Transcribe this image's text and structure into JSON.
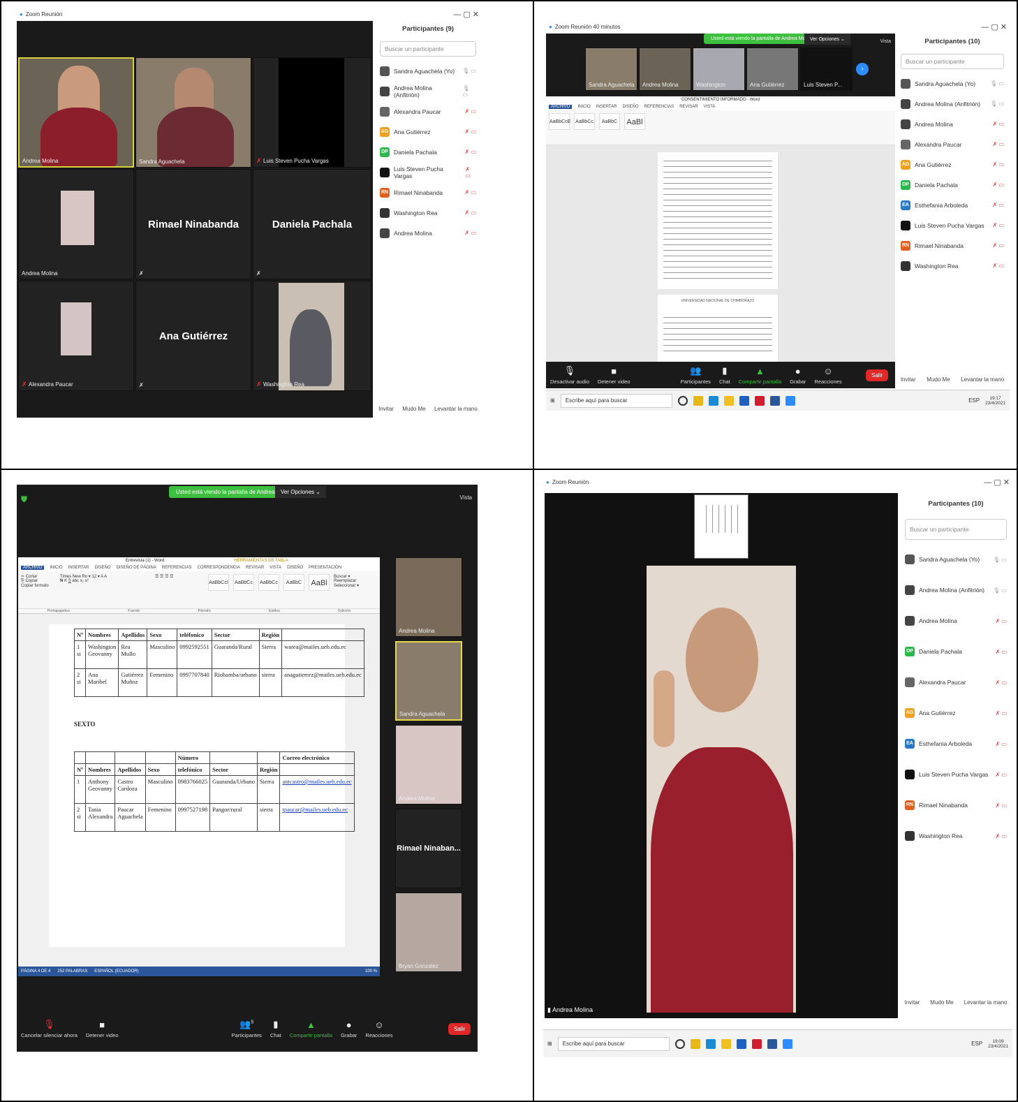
{
  "q1": {
    "window_title": "Zoom Reunión",
    "tiles": [
      {
        "name": "Andrea Molina"
      },
      {
        "name": "Sandra Aguachela"
      },
      {
        "name": "Luis Steven Pucha Vargas"
      },
      {
        "name": "Andrea Molina"
      },
      {
        "name": "",
        "big": "Rimael Ninabanda"
      },
      {
        "name": "",
        "big": "Daniela Pachala"
      },
      {
        "name": "Alexandra Paucar"
      },
      {
        "name": "",
        "big": "Ana Gutiérrez"
      },
      {
        "name": "Washington Rea"
      }
    ],
    "panel": {
      "title": "Participantes (9)",
      "search_placeholder": "Buscar un participante",
      "participants": [
        {
          "name": "Sandra Aguachela (Yo)",
          "avatar": "",
          "color": "#555"
        },
        {
          "name": "Andrea Molina (Anfitrión)",
          "avatar": "",
          "color": "#444"
        },
        {
          "name": "Alexandra Paucar",
          "avatar": "",
          "color": "#666"
        },
        {
          "name": "Ana Gutiérrez",
          "avatar": "AG",
          "color": "#f0a020"
        },
        {
          "name": "Daniela Pachala",
          "avatar": "DP",
          "color": "#2db84b"
        },
        {
          "name": "Luis Steven Pucha Vargas",
          "avatar": "",
          "color": "#111"
        },
        {
          "name": "Rimael Ninabanda",
          "avatar": "RN",
          "color": "#e06020"
        },
        {
          "name": "Washington Rea",
          "avatar": "",
          "color": "#333"
        },
        {
          "name": "Andrea Molina",
          "avatar": "",
          "color": "#444"
        }
      ],
      "footer": [
        "Invitar",
        "Mudo Me",
        "Levantar la mano"
      ]
    }
  },
  "q2": {
    "window_title": "Zoom Reunión 40 minutos",
    "banner": "Usted está viendo la pantalla de Andrea Molina",
    "options": "Ver Opciones ⌄",
    "view": "Vista",
    "thumbs": [
      "Sandra Aguachela",
      "Andrea Molina",
      "Washington",
      "Ana Gutiérrez",
      "Luis Steven P..."
    ],
    "doc_title": "CONSENTIMIENTO INFORMADO - Word",
    "doc_page2_header": "UNIVERSIDAD NACIONAL DE CHIMBORAZO",
    "panel": {
      "title": "Participantes (10)",
      "search_placeholder": "Buscar un participante",
      "participants": [
        {
          "name": "Sandra Aguachela (Yo)",
          "avatar": "",
          "color": "#555"
        },
        {
          "name": "Andrea Molina (Anfitrión)",
          "avatar": "",
          "color": "#444"
        },
        {
          "name": "Andrea Molina",
          "avatar": "",
          "color": "#444"
        },
        {
          "name": "Alexandra Paucar",
          "avatar": "",
          "color": "#666"
        },
        {
          "name": "Ana Gutiérrez",
          "avatar": "AG",
          "color": "#f0a020"
        },
        {
          "name": "Daniela Pachala",
          "avatar": "DP",
          "color": "#2db84b"
        },
        {
          "name": "Esthefania Arboleda",
          "avatar": "EA",
          "color": "#2a78c8"
        },
        {
          "name": "Luis Steven Pucha Vargas",
          "avatar": "",
          "color": "#111"
        },
        {
          "name": "Rimael Ninabanda",
          "avatar": "RN",
          "color": "#e06020"
        },
        {
          "name": "Washington Rea",
          "avatar": "",
          "color": "#333"
        }
      ],
      "footer": [
        "Invitar",
        "Mudo Me",
        "Levantar la mano"
      ]
    },
    "toolbar": [
      "Desactivar audio",
      "Detener video",
      "Participantes",
      "Chat",
      "Compartir pantalla",
      "Grabar",
      "Reacciones"
    ],
    "leave": "Salir",
    "taskbar": {
      "search": "Escribe aquí para buscar",
      "lang": "ESP",
      "time": "19:17",
      "date": "23/4/2021"
    }
  },
  "q3": {
    "banner": "Usted está viendo la pantalla de Andrea Molina",
    "options": "Ver Opciones ⌄",
    "view": "Vista",
    "word_title": "Entrevista (1) - Word",
    "tools_label": "HERRAMIENTAS DE TABLA",
    "tabs": [
      "ARCHIVO",
      "INICIO",
      "INSERTAR",
      "DISEÑO",
      "DISEÑO DE PÁGINA",
      "REFERENCIAS",
      "CORRESPONDENCIA",
      "REVISAR",
      "VISTA",
      "DISEÑO",
      "PRESENTACIÓN"
    ],
    "ribbon_groups": [
      "Portapapeles",
      "Fuente",
      "Párrafo",
      "Estilos",
      "Edición"
    ],
    "table1": {
      "header": [
        "Nº",
        "Nombres",
        "Apellidos",
        "Sexo",
        "teléfonico",
        "Sector",
        "Región",
        ""
      ],
      "rows": [
        [
          "1 si",
          "Washington Geovanny",
          "Rea Mullo",
          "Masculino",
          "0992592551",
          "Guaranda/Rural",
          "Sierra",
          "warea@mailes.ueb.edu.ec"
        ],
        [
          "2 si",
          "Ana Maribel",
          "Gutiérrez Muñoz",
          "Femenino",
          "0997707840",
          "Riobamba/urbano",
          "sierra",
          "anagutierrez@mailes.ueb.edu.ec"
        ]
      ]
    },
    "section": "SEXTO",
    "table2": {
      "header_top": [
        "",
        "",
        "",
        "",
        "Número",
        "",
        "",
        "Correo electrónico"
      ],
      "header": [
        "Nº",
        "Nombres",
        "Apellidos",
        "Sexo",
        "telefónico",
        "Sector",
        "Región",
        ""
      ],
      "rows": [
        [
          "1",
          "Anthony Geovanny",
          "Castro Cardoza",
          "Masculino",
          "0983766025",
          "Guaranda/Urbano",
          "Sierra",
          "antcastro@mailes.ueb.edu.ec"
        ],
        [
          "2 si",
          "Tania Alexandra",
          "Paucar Aguachela",
          "Femenino",
          "0997527198",
          "Pangor/rural",
          "sierra",
          "tpaucar@mailes.ueb.edu.ec"
        ]
      ]
    },
    "status": [
      "PÁGINA 4 DE 4",
      "252 PALABRAS",
      "ESPAÑOL (ECUADOR)",
      "100 %"
    ],
    "side_tiles": [
      "Andrea Molina",
      "Sandra Aguachela",
      "Andrea Molina",
      "Rimael Ninaban...",
      "Bryan Gonzalez"
    ],
    "toolbar": [
      "Cancelar silenciar ahora",
      "Detener video",
      "Participantes",
      "Chat",
      "Compartir pantalla",
      "Grabar",
      "Reacciones"
    ],
    "participants_count": "5",
    "leave": "Salir"
  },
  "q4": {
    "window_title": "Zoom Reunión",
    "speaker": "Andrea Molina",
    "panel": {
      "title": "Participantes (10)",
      "search_placeholder": "Buscar un participante",
      "participants": [
        {
          "name": "Sandra Aguachela (Yo)",
          "avatar": "",
          "color": "#555"
        },
        {
          "name": "Andrea Molina (Anfitrión)",
          "avatar": "",
          "color": "#444"
        },
        {
          "name": "Andrea Molina",
          "avatar": "",
          "color": "#444"
        },
        {
          "name": "Daniela Pachala",
          "avatar": "DP",
          "color": "#2db84b"
        },
        {
          "name": "Alexandra Paucar",
          "avatar": "",
          "color": "#666"
        },
        {
          "name": "Ana Gutiérrez",
          "avatar": "AG",
          "color": "#f0a020"
        },
        {
          "name": "Esthefania Arboleda",
          "avatar": "EA",
          "color": "#2a78c8"
        },
        {
          "name": "Luis Steven Pucha Vargas",
          "avatar": "",
          "color": "#111"
        },
        {
          "name": "Rimael Ninabanda",
          "avatar": "RN",
          "color": "#e06020"
        },
        {
          "name": "Washington Rea",
          "avatar": "",
          "color": "#333"
        }
      ],
      "footer": [
        "Invitar",
        "Mudo Me",
        "Levantar la mano"
      ]
    },
    "taskbar": {
      "search": "Escribe aquí para buscar",
      "lang": "ESP",
      "time": "19:09",
      "date": "23/4/2021"
    }
  }
}
